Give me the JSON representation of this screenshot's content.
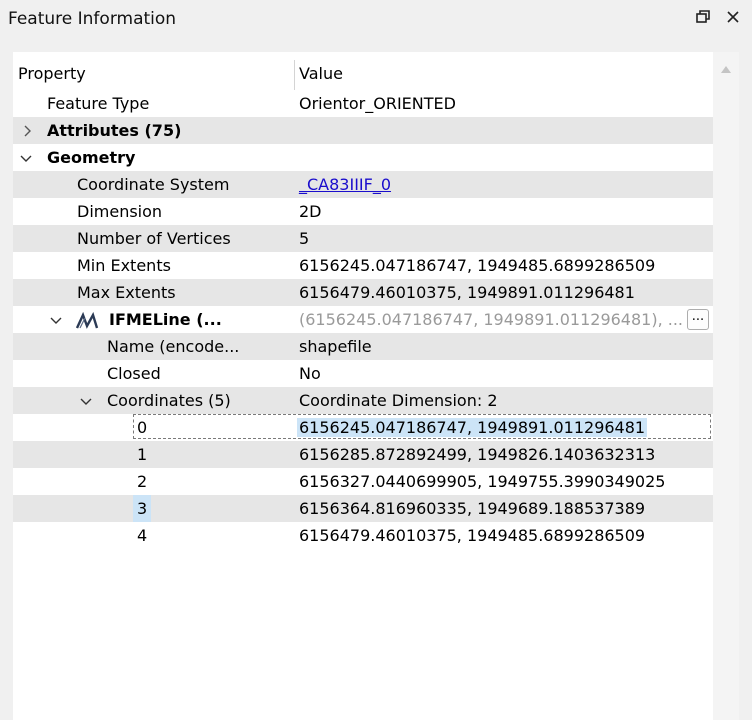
{
  "window": {
    "title": "Feature Information",
    "restore_icon": "restore-window-icon",
    "close_icon": "close-icon"
  },
  "table": {
    "headers": {
      "property": "Property",
      "value": "Value"
    },
    "rows": [
      {
        "property": "Feature Type",
        "value": "Orientor_ORIENTED"
      },
      {
        "property": "Attributes (75)",
        "value": ""
      },
      {
        "property": "Geometry",
        "value": ""
      },
      {
        "property": "Coordinate System",
        "value": "_CA83IIIF_0"
      },
      {
        "property": "Dimension",
        "value": "2D"
      },
      {
        "property": "Number of Vertices",
        "value": "5"
      },
      {
        "property": "Min Extents",
        "value": "6156245.047186747, 1949485.6899286509"
      },
      {
        "property": "Max Extents",
        "value": "6156479.46010375, 1949891.011296481"
      },
      {
        "property": "IFMELine (...",
        "value": "(6156245.047186747, 1949891.011296481), ..."
      },
      {
        "property": "Name (encode...",
        "value": "shapefile"
      },
      {
        "property": "Closed",
        "value": "No"
      },
      {
        "property": "Coordinates (5)",
        "value": "Coordinate Dimension: 2"
      },
      {
        "property": "0",
        "value": "6156245.047186747, 1949891.011296481"
      },
      {
        "property": "1",
        "value": "6156285.872892499, 1949826.1403632313"
      },
      {
        "property": "2",
        "value": "6156327.0440699905, 1949755.3990349025"
      },
      {
        "property": "3",
        "value": "6156364.816960335, 1949689.188537389"
      },
      {
        "property": "4",
        "value": "6156479.46010375, 1949485.6899286509"
      }
    ],
    "ellipsis_button": "..."
  }
}
